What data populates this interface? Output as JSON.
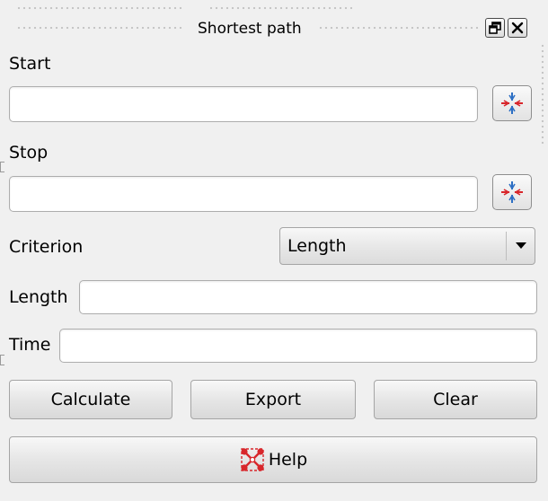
{
  "window": {
    "title": "Shortest path"
  },
  "icons": {
    "float": "float-window-icon",
    "close": "close-icon",
    "capture_point": "capture-point-icon",
    "combo_arrow": "chevron-down-icon",
    "help": "help-icon"
  },
  "start": {
    "label": "Start",
    "value": ""
  },
  "stop": {
    "label": "Stop",
    "value": ""
  },
  "criterion": {
    "label": "Criterion",
    "selected": "Length"
  },
  "length": {
    "label": "Length",
    "value": ""
  },
  "time": {
    "label": "Time",
    "value": ""
  },
  "buttons": {
    "calculate": "Calculate",
    "export": "Export",
    "clear": "Clear",
    "help": "Help"
  },
  "colors": {
    "background": "#f0f0f0",
    "capture_icon_red": "#d8262b",
    "capture_icon_blue": "#2d6fc4"
  }
}
